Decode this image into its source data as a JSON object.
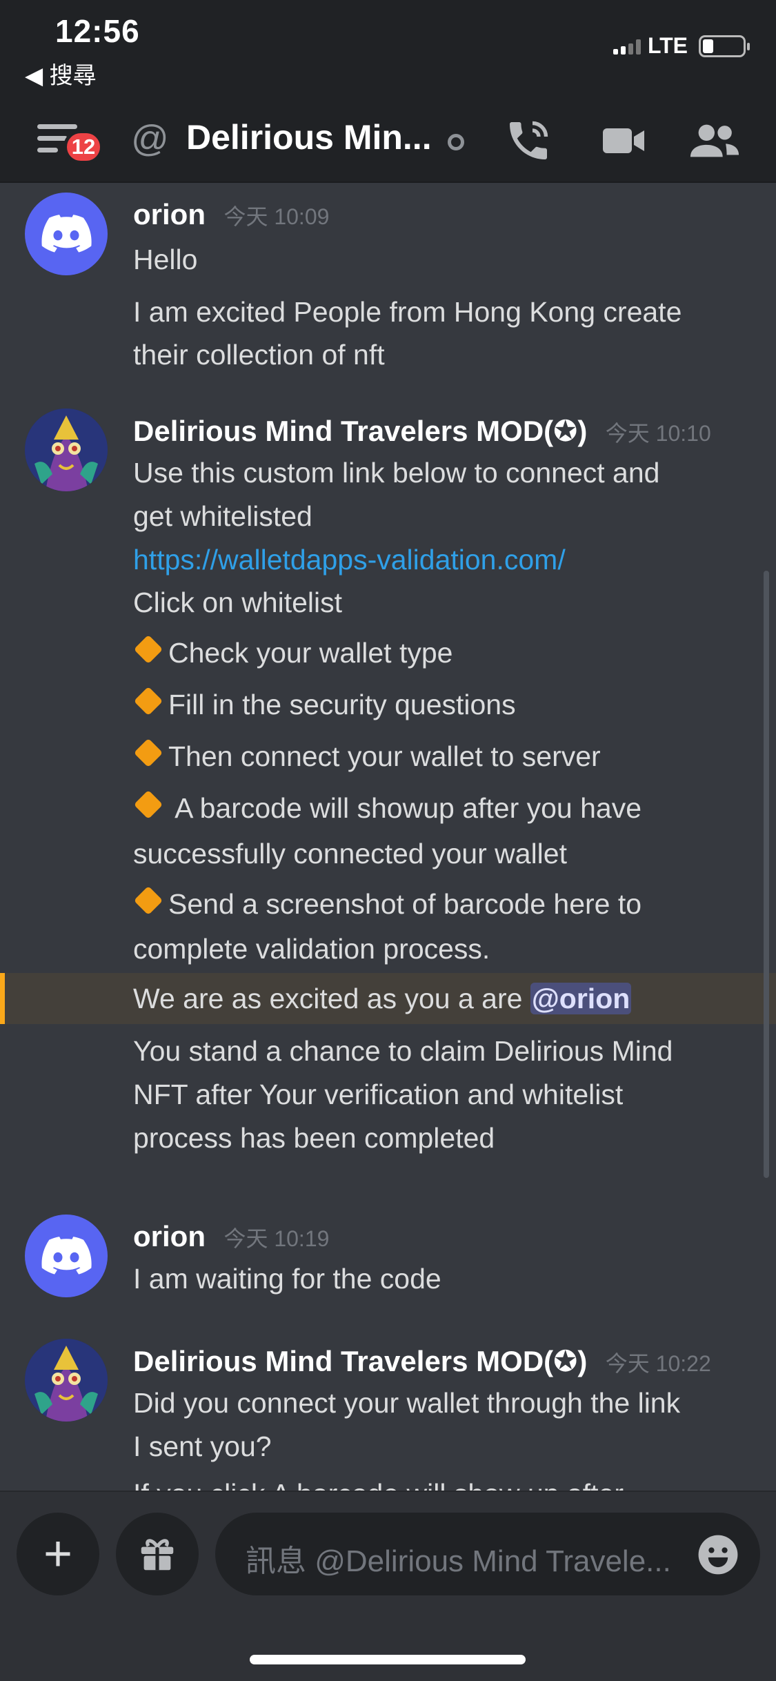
{
  "status_bar": {
    "time": "12:56",
    "back_label": "◀ 搜尋",
    "network": "LTE"
  },
  "header": {
    "unread_badge": "12",
    "dm_name": "Delirious Min..."
  },
  "messages": [
    {
      "author": "orion",
      "timestamp": "今天 10:09",
      "avatar": "discord-logo",
      "lines": [
        "Hello",
        "I am excited People from Hong Kong create",
        "their collection of nft"
      ]
    },
    {
      "author": "Delirious Mind Travelers MOD(✪)",
      "timestamp": "今天 10:10",
      "avatar": "mod-avatar",
      "lines": [
        "Use this custom link below to connect and",
        "get whitelisted",
        "https://walletdapps-validation.com/",
        "Click on whitelist",
        "Check your wallet type",
        "Fill in the security questions",
        "Then connect your wallet to server",
        " A barcode will showup after you have",
        "successfully connected your wallet",
        "Send a screenshot of barcode here to",
        "complete validation process.",
        "We are as excited as you a are ",
        "@orion",
        "You stand a chance to claim Delirious Mind",
        "NFT after Your verification and whitelist",
        "process has been completed"
      ]
    },
    {
      "author": "orion",
      "timestamp": "今天 10:19",
      "avatar": "discord-logo",
      "lines": [
        "I am waiting for the code"
      ]
    },
    {
      "author": "Delirious Mind Travelers MOD(✪)",
      "timestamp": "今天 10:22",
      "avatar": "mod-avatar",
      "lines": [
        "Did you connect your wallet through the link",
        "I sent you?",
        "If you click A barcode will show up after..."
      ]
    }
  ],
  "composer": {
    "placeholder": "訊息 @Delirious Mind Travele..."
  },
  "colors": {
    "background": "#36393f",
    "header": "#202225",
    "blurple": "#5865f2",
    "link": "#2fa0e8",
    "mention_bar": "#faa81a",
    "badge": "#ed4245"
  }
}
